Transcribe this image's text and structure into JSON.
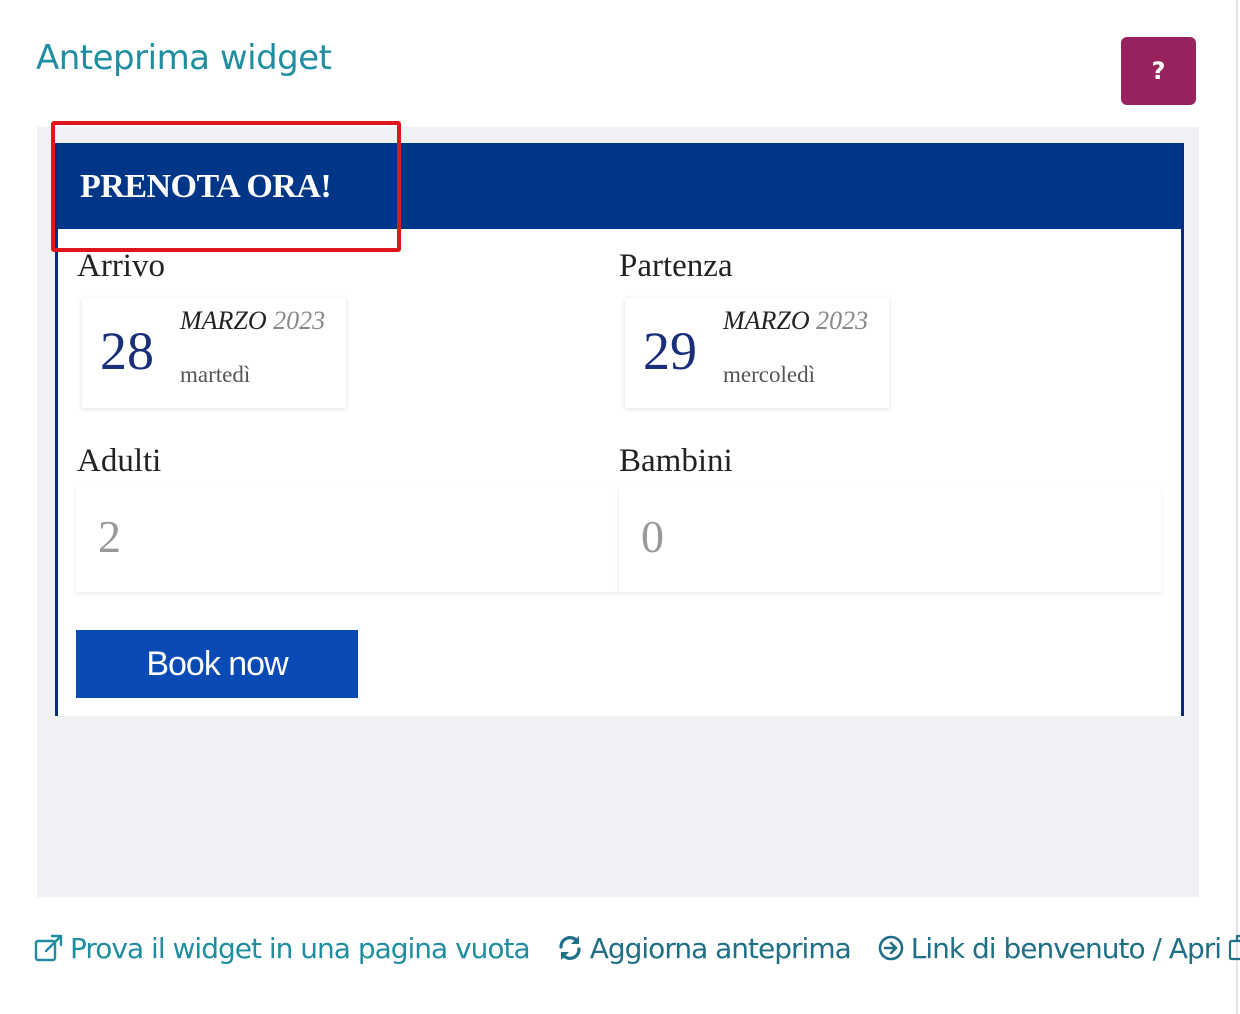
{
  "panel": {
    "title": "Anteprima widget",
    "help_label": "?"
  },
  "widget": {
    "header": "PRENOTA ORA!",
    "arrival": {
      "label": "Arrivo",
      "day": "28",
      "month": "MARZO",
      "year": "2023",
      "weekday": "martedì"
    },
    "departure": {
      "label": "Partenza",
      "day": "29",
      "month": "MARZO",
      "year": "2023",
      "weekday": "mercoledì"
    },
    "adults": {
      "label": "Adulti",
      "value": "2"
    },
    "children": {
      "label": "Bambini",
      "value": "0"
    },
    "book_label": "Book now"
  },
  "footer": {
    "try_link": "Prova il widget in una pagina vuota",
    "refresh_link": "Aggiorna anteprima",
    "welcome_link": "Link di benvenuto / Apri"
  },
  "icons": {
    "help": "question-icon",
    "try": "external-link-icon",
    "refresh": "refresh-icon",
    "welcome": "arrow-circle-right-icon",
    "copy": "copy-icon"
  },
  "colors": {
    "accent": "#1f8ea0",
    "help_button": "#98225e",
    "widget_header": "#003687",
    "book_button": "#0a4ab5",
    "highlight": "#e0161c"
  }
}
